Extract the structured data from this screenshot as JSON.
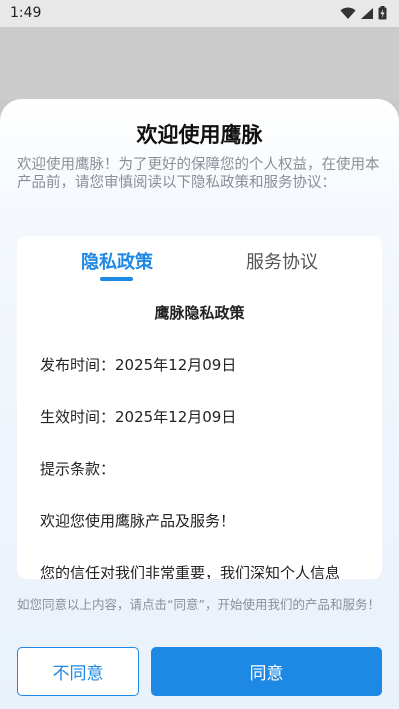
{
  "status_bar": {
    "time": "1:49",
    "icons": [
      "wifi-icon",
      "signal-icon",
      "battery-charging-icon"
    ]
  },
  "dialog": {
    "title": "欢迎使用鹰脉",
    "intro": "欢迎使用鹰脉！为了更好的保障您的个人权益，在使用本产品前，请您审慎阅读以下隐私政策和服务协议：",
    "tabs": [
      {
        "label": "隐私政策",
        "active": true
      },
      {
        "label": "服务协议",
        "active": false
      }
    ],
    "document": {
      "title": "鹰脉隐私政策",
      "lines": [
        "发布时间：2025年12月09日",
        "生效时间：2025年12月09日",
        "提示条款：",
        "欢迎您使用鹰脉产品及服务！",
        "您的信任对我们非常重要，我们深知个人信息"
      ]
    },
    "footer_note": "如您同意以上内容，请点击“同意”，开始使用我们的产品和服务！",
    "buttons": {
      "disagree": "不同意",
      "agree": "同意"
    }
  },
  "colors": {
    "accent": "#1e88e5",
    "muted_text": "#8a8f96",
    "scrim": "#c9c9c9"
  }
}
